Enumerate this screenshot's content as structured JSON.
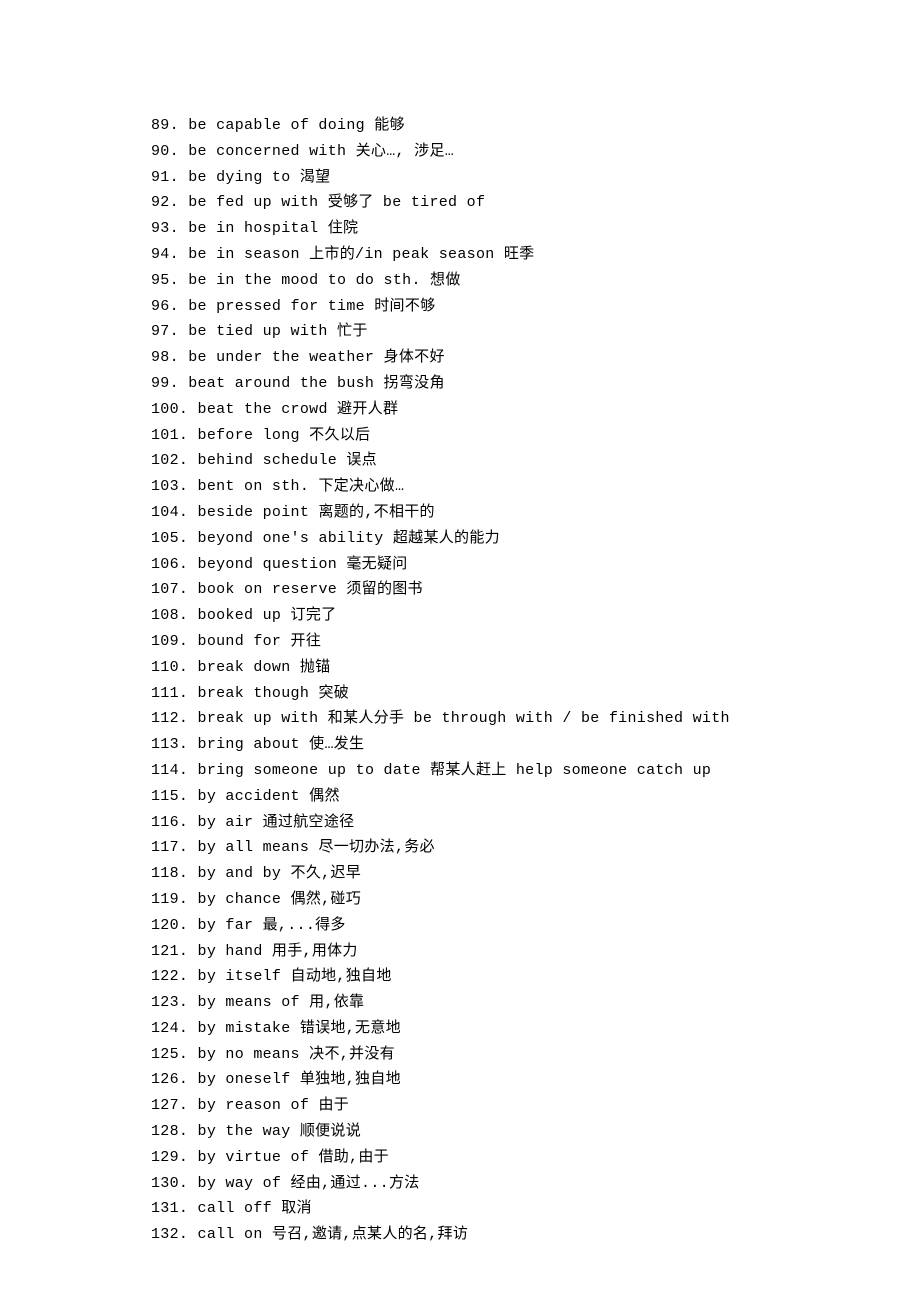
{
  "entries": [
    {
      "n": "89.",
      "t": " be capable of doing 能够"
    },
    {
      "n": "90.",
      "t": " be concerned with 关心…, 涉足…"
    },
    {
      "n": "91.",
      "t": " be dying to 渴望"
    },
    {
      "n": "92.",
      "t": " be fed up with 受够了 be tired of"
    },
    {
      "n": "93.",
      "t": " be in hospital 住院"
    },
    {
      "n": "94.",
      "t": " be in season 上市的/in peak season 旺季"
    },
    {
      "n": "95.",
      "t": " be in the mood to do sth. 想做"
    },
    {
      "n": "96.",
      "t": " be pressed for time 时间不够"
    },
    {
      "n": "97.",
      "t": " be tied up with 忙于"
    },
    {
      "n": "98.",
      "t": " be under the weather 身体不好"
    },
    {
      "n": "99.",
      "t": " beat around the bush 拐弯没角"
    },
    {
      "n": "100.",
      "t": " beat the crowd 避开人群"
    },
    {
      "n": "101.",
      "t": " before long 不久以后"
    },
    {
      "n": "102.",
      "t": " behind schedule 误点"
    },
    {
      "n": "103.",
      "t": " bent on sth. 下定决心做…"
    },
    {
      "n": "104.",
      "t": " beside point 离题的,不相干的"
    },
    {
      "n": "105.",
      "t": " beyond one's ability 超越某人的能力"
    },
    {
      "n": "106.",
      "t": " beyond question 毫无疑问"
    },
    {
      "n": "107.",
      "t": " book on reserve 须留的图书"
    },
    {
      "n": "108.",
      "t": " booked up 订完了"
    },
    {
      "n": "109.",
      "t": " bound for 开往"
    },
    {
      "n": "110.",
      "t": " break down 抛锚"
    },
    {
      "n": "111.",
      "t": " break though 突破"
    },
    {
      "n": "112.",
      "t": " break up with 和某人分手 be through with / be finished with"
    },
    {
      "n": "113.",
      "t": " bring about 使…发生"
    },
    {
      "n": "114.",
      "t": " bring someone up to date 帮某人赶上 help someone catch up"
    },
    {
      "n": "115.",
      "t": " by accident 偶然"
    },
    {
      "n": "116.",
      "t": " by air 通过航空途径"
    },
    {
      "n": "117.",
      "t": " by all means 尽一切办法,务必"
    },
    {
      "n": "118.",
      "t": " by and by 不久,迟早"
    },
    {
      "n": "119.",
      "t": " by chance 偶然,碰巧"
    },
    {
      "n": "120.",
      "t": " by far 最,...得多"
    },
    {
      "n": "121.",
      "t": " by hand 用手,用体力"
    },
    {
      "n": "122.",
      "t": " by itself 自动地,独自地"
    },
    {
      "n": "123.",
      "t": " by means of 用,依靠"
    },
    {
      "n": "124.",
      "t": " by mistake 错误地,无意地"
    },
    {
      "n": "125.",
      "t": " by no means 决不,并没有"
    },
    {
      "n": "126.",
      "t": " by oneself 单独地,独自地"
    },
    {
      "n": "127.",
      "t": " by reason of 由于"
    },
    {
      "n": "128.",
      "t": " by the way 顺便说说"
    },
    {
      "n": "129.",
      "t": " by virtue of 借助,由于"
    },
    {
      "n": "130.",
      "t": " by way of 经由,通过...方法"
    },
    {
      "n": "131.",
      "t": " call off 取消"
    },
    {
      "n": "132.",
      "t": " call on 号召,邀请,点某人的名,拜访"
    }
  ]
}
